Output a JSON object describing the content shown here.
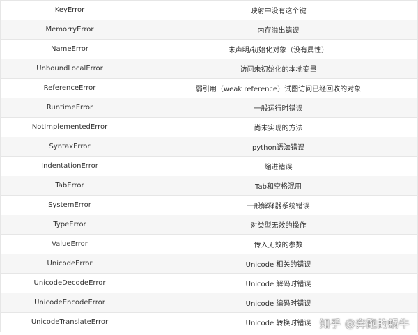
{
  "rows": [
    {
      "name": "KeyError",
      "desc": "映射中没有这个键"
    },
    {
      "name": "MemorryError",
      "desc": "内存溢出错误"
    },
    {
      "name": "NameError",
      "desc": "未声明/初始化对象（没有属性）"
    },
    {
      "name": "UnboundLocalError",
      "desc": "访问未初始化的本地变量"
    },
    {
      "name": "ReferenceError",
      "desc": "弱引用（weak reference）试图访问已经回收的对象"
    },
    {
      "name": "RuntimeError",
      "desc": "一般运行时错误"
    },
    {
      "name": "NotImplementedError",
      "desc": "尚未实现的方法"
    },
    {
      "name": "SyntaxError",
      "desc": "python语法错误"
    },
    {
      "name": "IndentationError",
      "desc": "缩进错误"
    },
    {
      "name": "TabError",
      "desc": "Tab和空格混用"
    },
    {
      "name": "SystemError",
      "desc": "一般解释器系统错误"
    },
    {
      "name": "TypeError",
      "desc": "对类型无效的操作"
    },
    {
      "name": "ValueError",
      "desc": "传入无效的参数"
    },
    {
      "name": "UnicodeError",
      "desc": "Unicode 相关的错误"
    },
    {
      "name": "UnicodeDecodeError",
      "desc": "Unicode 解码时错误"
    },
    {
      "name": "UnicodeEncodeError",
      "desc": "Unicode 编码时错误"
    },
    {
      "name": "UnicodeTranslateError",
      "desc": "Unicode 转换时错误"
    }
  ],
  "watermark": "知乎 @奔跑的蜗牛"
}
